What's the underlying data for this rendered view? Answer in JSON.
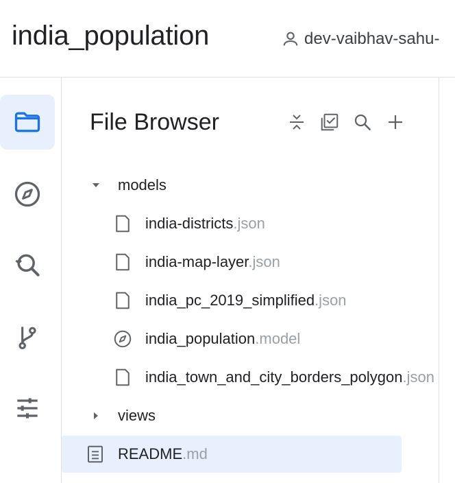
{
  "header": {
    "project_title": "india_population",
    "user_name": "dev-vaibhav-sahu-"
  },
  "rail": {
    "items": [
      {
        "name": "files",
        "icon": "folder-icon",
        "active": true
      },
      {
        "name": "explore",
        "icon": "compass-icon",
        "active": false
      },
      {
        "name": "search",
        "icon": "search-history-icon",
        "active": false
      },
      {
        "name": "source-control",
        "icon": "git-branch-icon",
        "active": false
      },
      {
        "name": "settings",
        "icon": "sliders-icon",
        "active": false
      }
    ]
  },
  "file_browser": {
    "title": "File Browser",
    "toolbar": [
      "collapse-all-icon",
      "select-icon",
      "search-icon",
      "add-icon"
    ],
    "tree": [
      {
        "type": "folder",
        "expanded": true,
        "name": "models"
      },
      {
        "type": "file",
        "icon": "file-icon",
        "base": "india-districts",
        "ext": ".json"
      },
      {
        "type": "file",
        "icon": "file-icon",
        "base": "india-map-layer",
        "ext": ".json"
      },
      {
        "type": "file",
        "icon": "file-icon",
        "base": "india_pc_2019_simplified",
        "ext": ".json"
      },
      {
        "type": "file",
        "icon": "compass-icon",
        "base": "india_population",
        "ext": ".model"
      },
      {
        "type": "file",
        "icon": "file-icon",
        "base": "india_town_and_city_borders_polygon",
        "ext": ".json"
      },
      {
        "type": "folder",
        "expanded": false,
        "name": "views"
      },
      {
        "type": "file",
        "icon": "document-icon",
        "base": "README",
        "ext": ".md",
        "selected": true
      }
    ]
  },
  "colors": {
    "accent": "#1a73e8",
    "selected_bg": "#e8f0fe",
    "icon_gray": "#5f6368",
    "ext_gray": "#9aa0a6"
  }
}
